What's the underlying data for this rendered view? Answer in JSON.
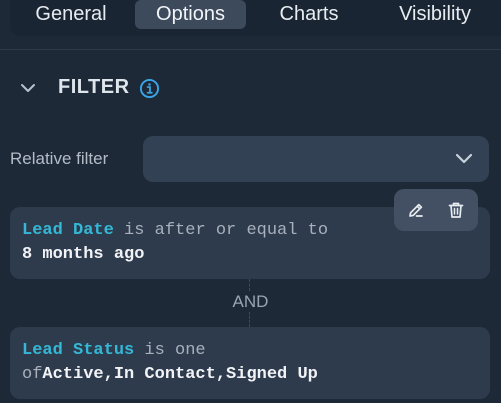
{
  "tabs": [
    {
      "label": "General"
    },
    {
      "label": "Options",
      "active": true
    },
    {
      "label": "Charts"
    },
    {
      "label": "Visibility"
    }
  ],
  "filter_section": {
    "title": "FILTER",
    "relative_filter_label": "Relative filter",
    "relative_filter_value": ""
  },
  "conditions": [
    {
      "field": "Lead Date",
      "operator": "is after or equal to",
      "value": "8 months ago"
    },
    {
      "field": "Lead Status",
      "operator": "is one",
      "prefix": "of",
      "value": "Active,In Contact,Signed Up"
    }
  ],
  "connector": "AND",
  "colors": {
    "background": "#1e2937",
    "field_accent": "#34b8d6",
    "card": "#2e3b4d",
    "active_tab": "#3d4a5c"
  },
  "icons": [
    "chevron-down-icon",
    "info-icon",
    "edit-icon",
    "trash-icon"
  ]
}
